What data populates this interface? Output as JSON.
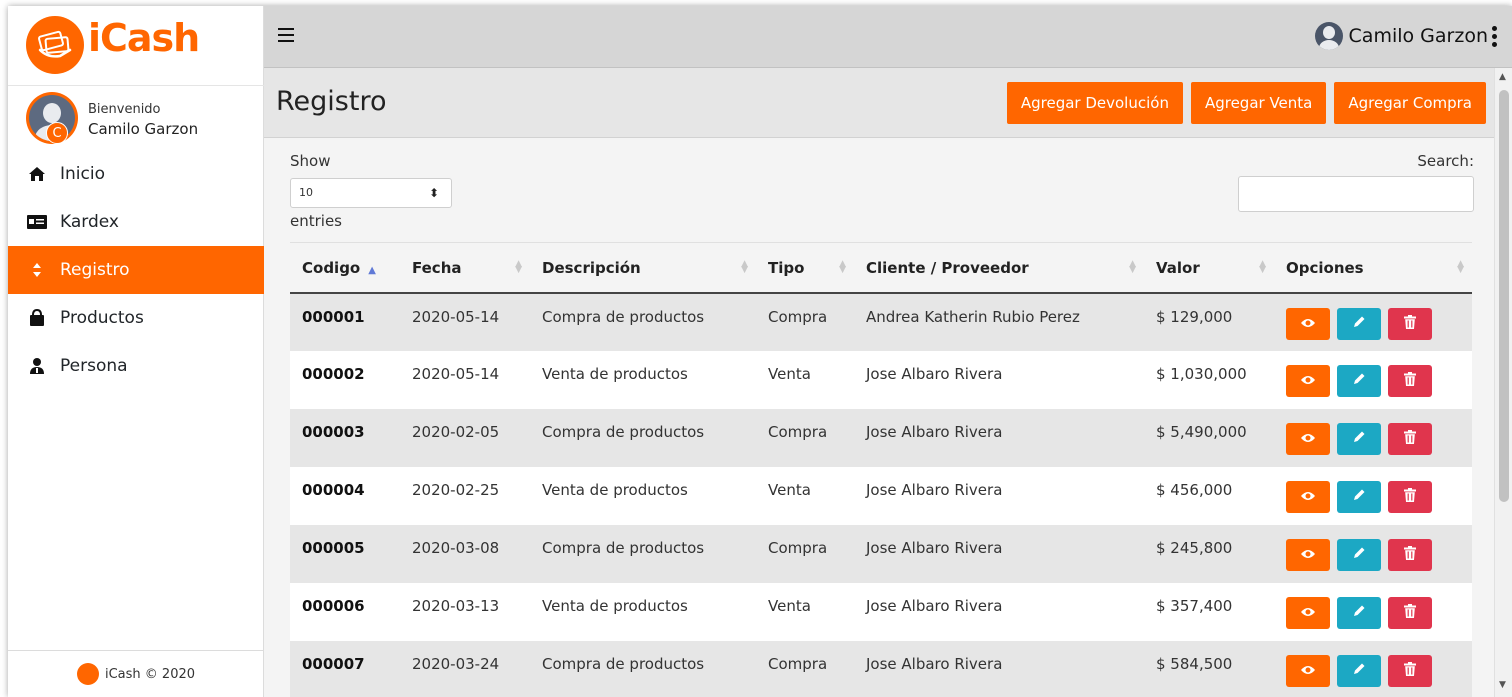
{
  "app": {
    "brand_name": "iCash",
    "footer": "iCash © 2020"
  },
  "user": {
    "welcome": "Bienvenido",
    "name": "Camilo Garzon",
    "badge": "C"
  },
  "sidebar": {
    "items": [
      {
        "label": "Inicio",
        "icon": "home-icon",
        "active": false
      },
      {
        "label": "Kardex",
        "icon": "card-icon",
        "active": false
      },
      {
        "label": "Registro",
        "icon": "sort-icon",
        "active": true
      },
      {
        "label": "Productos",
        "icon": "shopping-bag-icon",
        "active": false
      },
      {
        "label": "Persona",
        "icon": "person-icon",
        "active": false
      }
    ]
  },
  "topbar": {
    "user_name": "Camilo Garzon"
  },
  "header": {
    "title": "Registro",
    "buttons": {
      "devolucion": "Agregar Devolución",
      "venta": "Agregar Venta",
      "compra": "Agregar Compra"
    }
  },
  "table_controls": {
    "show": "Show",
    "page_size": "10",
    "entries": "entries",
    "search_label": "Search:"
  },
  "table": {
    "columns": [
      "Codigo",
      "Fecha",
      "Descripción",
      "Tipo",
      "Cliente / Proveedor",
      "Valor",
      "Opciones"
    ],
    "rows": [
      [
        "000001",
        "2020-05-14",
        "Compra de productos",
        "Compra",
        "Andrea Katherin Rubio Perez",
        "$ 129,000"
      ],
      [
        "000002",
        "2020-05-14",
        "Venta de productos",
        "Venta",
        "Jose Albaro Rivera",
        "$ 1,030,000"
      ],
      [
        "000003",
        "2020-02-05",
        "Compra de productos",
        "Compra",
        "Jose Albaro Rivera",
        "$ 5,490,000"
      ],
      [
        "000004",
        "2020-02-25",
        "Venta de productos",
        "Venta",
        "Jose Albaro Rivera",
        "$ 456,000"
      ],
      [
        "000005",
        "2020-03-08",
        "Compra de productos",
        "Compra",
        "Jose Albaro Rivera",
        "$ 245,800"
      ],
      [
        "000006",
        "2020-03-13",
        "Venta de productos",
        "Venta",
        "Jose Albaro Rivera",
        "$ 357,400"
      ],
      [
        "000007",
        "2020-03-24",
        "Compra de productos",
        "Compra",
        "Jose Albaro Rivera",
        "$ 584,500"
      ]
    ]
  },
  "colors": {
    "accent": "#ff6600",
    "edit": "#1ca8c4",
    "delete": "#e0354d",
    "sort_active": "#5f79d6"
  }
}
